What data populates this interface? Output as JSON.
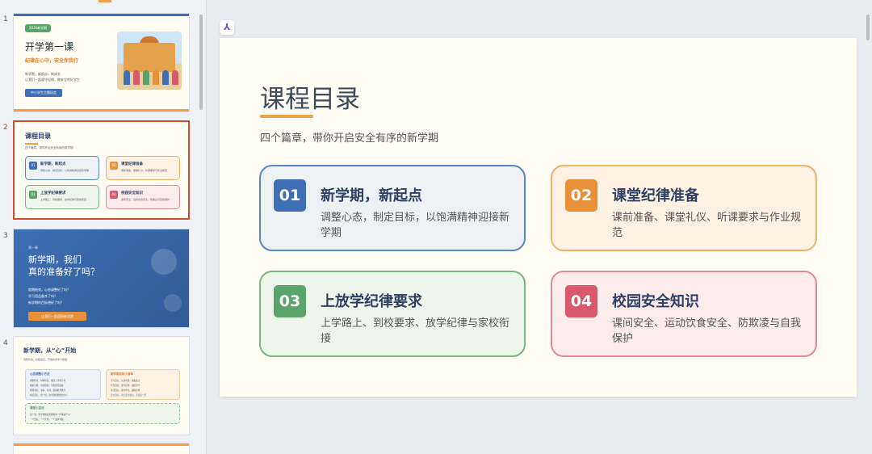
{
  "thumbnails": {
    "numbers": [
      "1",
      "2",
      "3",
      "4"
    ],
    "slide1": {
      "tag": "2026新学期",
      "title": "开学第一课",
      "subtitle": "纪律在心中，安全伴我行",
      "lines": [
        "新学期，新起点，新成长",
        "让我们一起遵守纪律，做安全的好学生"
      ],
      "button": "中小学生主题班会"
    },
    "slide2": {
      "title": "课程目录",
      "subtitle": "四个篇章，带你开启安全有序的新学期",
      "cards": [
        {
          "num": "01",
          "title": "新学期，新起点",
          "desc": "调整心态，制定目标，以饱满精神迎接新学期"
        },
        {
          "num": "02",
          "title": "课堂纪律准备",
          "desc": "课前准备、课堂礼仪、听课要求与作业规范"
        },
        {
          "num": "03",
          "title": "上放学纪律要求",
          "desc": "上学路上、到校要求、放学纪律与家校衔接"
        },
        {
          "num": "04",
          "title": "校园安全知识",
          "desc": "课间安全、运动饮食安全、防欺凌与自我保护"
        }
      ]
    },
    "slide3": {
      "small": "第一章",
      "title_line1": "新学期，我们",
      "title_line2": "真的准备好了吗？",
      "lines": [
        "假期结束，心态调整好了吗？",
        "学习用品备齐了吗？",
        "新学期的目标想好了吗？"
      ],
      "button": "让我们一起迎接新学期"
    },
    "slide4": {
      "title": "新学期，从“心”开始",
      "subtitle": "调整状态，积极适应，开始新的学习旅程",
      "box_left_title": "心态调整小方法",
      "box_left_rows": [
        "调整作息：早睡早起，找回上学的节奏",
        "收拾心情：告别假期，带着期待返校",
        "整理书包：书本、文具，提前检查整齐",
        "制定目标：想一想，新学期想要做到什么"
      ],
      "box_right_title": "新学期目标小清单",
      "box_right_rows": [
        "学习目标：认真听讲，积极发言",
        "行为目标：遵守纪律，团结同学",
        "生活目标：按时作息，锻炼身体",
        "安全目标：牢记安全知识，平安每一天"
      ],
      "box_bottom_title": "课堂小互动",
      "box_bottom_rows": [
        "说一说：新学期你最想做到的一件事是什么？",
        "一个目标，一个计划，一个进步的我。"
      ]
    }
  },
  "main": {
    "title": "课程目录",
    "subtitle": "四个篇章，带你开启安全有序的新学期",
    "cards": [
      {
        "num": "01",
        "title": "新学期，新起点",
        "desc": "调整心态，制定目标，以饱满精神迎接新学期"
      },
      {
        "num": "02",
        "title": "课堂纪律准备",
        "desc": "课前准备、课堂礼仪、听课要求与作业规范"
      },
      {
        "num": "03",
        "title": "上放学纪律要求",
        "desc": "上学路上、到校要求、放学纪律与家校衔接"
      },
      {
        "num": "04",
        "title": "校园安全知识",
        "desc": "课间安全、运动饮食安全、防欺凌与自我保护"
      }
    ]
  },
  "colors": {
    "blue": "#3e6eb4",
    "orange": "#e8913a",
    "green": "#5aa36a",
    "red": "#d8596b",
    "active_border": "#d24a2c"
  }
}
